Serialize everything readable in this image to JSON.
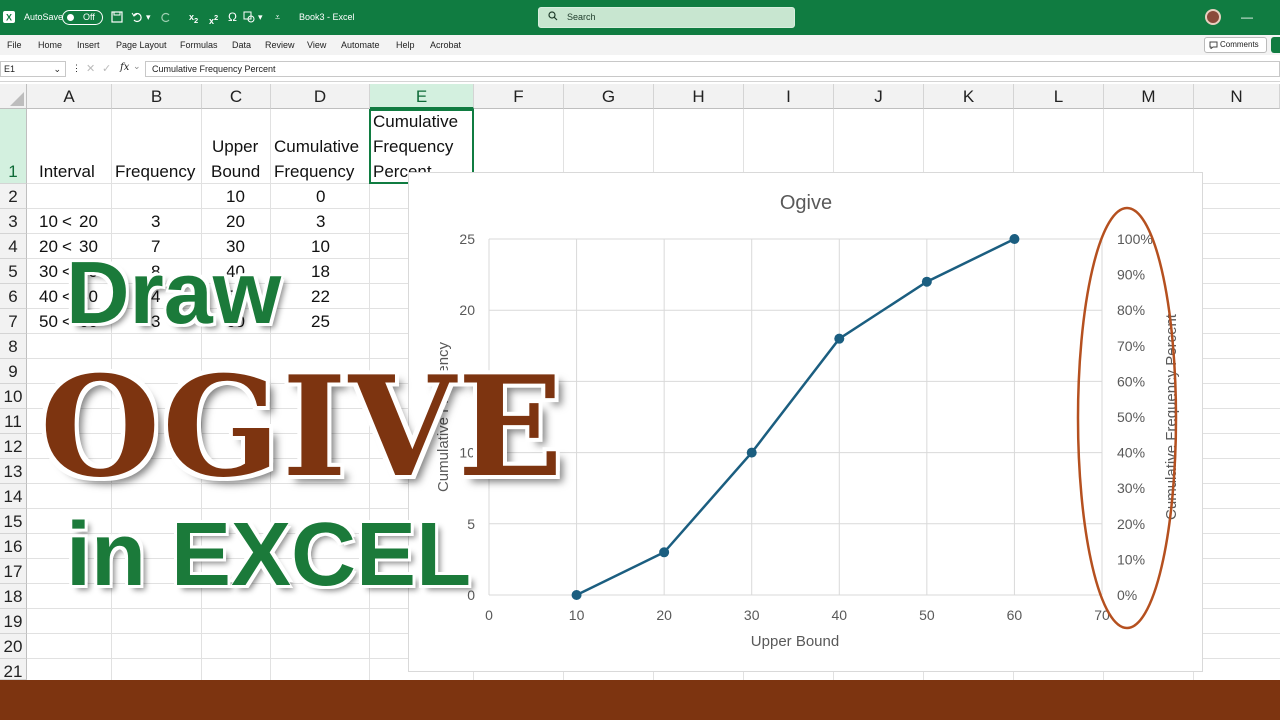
{
  "titlebar": {
    "autosave_label": "AutoSave",
    "autosave_state": "Off",
    "document_title": "Book3  -  Excel",
    "search_placeholder": "Search"
  },
  "menu": [
    "File",
    "Home",
    "Insert",
    "Page Layout",
    "Formulas",
    "Data",
    "Review",
    "View",
    "Automate",
    "Help",
    "Acrobat"
  ],
  "comments_label": "Comments",
  "formula_bar": {
    "name_box": "E1",
    "fx_label": "fx",
    "content": "Cumulative Frequency Percent"
  },
  "columns": [
    "A",
    "B",
    "C",
    "D",
    "E",
    "F",
    "G",
    "H",
    "I",
    "J",
    "K",
    "L",
    "M",
    "N"
  ],
  "rows": [
    "1",
    "2",
    "3",
    "4",
    "5",
    "6",
    "7",
    "8",
    "9",
    "10",
    "11",
    "12",
    "13",
    "14",
    "15",
    "16",
    "17",
    "18",
    "19",
    "20",
    "21"
  ],
  "sheet": {
    "headers": {
      "A": "Interval",
      "B": "Frequency",
      "C": [
        "Upper",
        "Bound"
      ],
      "D": [
        "Cumulative",
        "Frequency"
      ],
      "E": [
        "Cumulative",
        "Frequency",
        "Percent"
      ]
    },
    "row2": {
      "C": "10",
      "D": "0"
    },
    "data": [
      {
        "A_low": "10",
        "A_high": "20",
        "B": "3",
        "C": "20",
        "D": "3"
      },
      {
        "A_low": "20",
        "A_high": "30",
        "B": "7",
        "C": "30",
        "D": "10"
      },
      {
        "A_low": "30",
        "A_high": "40",
        "B": "8",
        "C": "40",
        "D": "18"
      },
      {
        "A_low": "40",
        "A_high": "50",
        "B": "4",
        "C": "50",
        "D": "22"
      },
      {
        "A_low": "50",
        "A_high": "60",
        "B": "3",
        "C": "60",
        "D": "25"
      }
    ],
    "interval_sep": "<"
  },
  "chart_data": {
    "type": "line",
    "title": "Ogive",
    "xlabel": "Upper Bound",
    "ylabel": "Cumulative Frequency",
    "y2label": "Cumulative Frequency Percent",
    "x": [
      10,
      20,
      30,
      40,
      50,
      60
    ],
    "series": [
      {
        "values": [
          0,
          3,
          10,
          18,
          22,
          25
        ]
      }
    ],
    "xlim": [
      0,
      70
    ],
    "xticks": [
      "0",
      "10",
      "20",
      "30",
      "40",
      "50",
      "60",
      "70"
    ],
    "ylim": [
      0,
      25
    ],
    "yticks": [
      "0",
      "5",
      "10",
      "15",
      "20",
      "25"
    ],
    "y2ticks": [
      "0%",
      "10%",
      "20%",
      "30%",
      "40%",
      "50%",
      "60%",
      "70%",
      "80%",
      "90%",
      "100%"
    ],
    "grid": true,
    "line_color": "#1b5e80",
    "highlight_color": "#b5501f"
  },
  "overlay": {
    "line1": "Draw",
    "line2": "OGIVE",
    "line3": "in EXCEL"
  },
  "colors": {
    "excel_green": "#107c41",
    "banner_brown": "#7d3410",
    "overlay_green": "#1b7a3a"
  }
}
